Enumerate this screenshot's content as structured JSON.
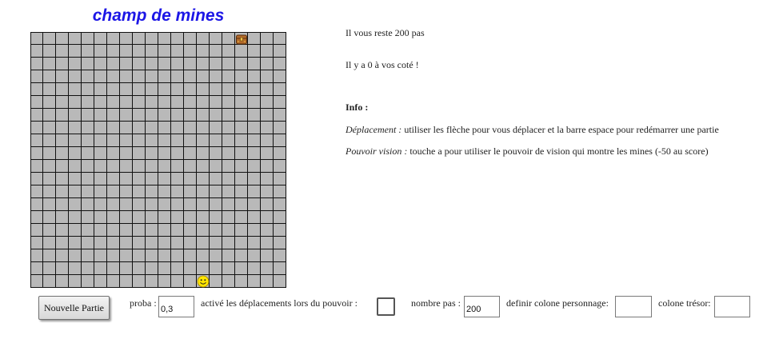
{
  "title": "champ de mines",
  "grid": {
    "cols": 20,
    "rows": 20,
    "treasure": {
      "col": 16,
      "row": 0
    },
    "player": {
      "col": 13,
      "row": 19
    }
  },
  "info": {
    "steps_left": "Il vous reste 200 pas",
    "adjacent": "Il y a 0 à vos coté !",
    "heading": "Info :",
    "move_label": "Déplacement :",
    "move_text": " utiliser les flèche pour vous déplacer et la barre espace pour redémarrer une partie",
    "vision_label": "Pouvoir vision :",
    "vision_text": " touche a pour utiliser le pouvoir de vision qui montre les mines (-50 au score)"
  },
  "controls": {
    "new_game": "Nouvelle Partie",
    "proba_label": "proba :",
    "proba_value": "0,3",
    "moves_label": "activé les déplacements lors du pouvoir :",
    "moves_checked": false,
    "steps_label": "nombre pas :",
    "steps_value": "200",
    "player_col_label": "definir colone personnage:",
    "player_col_value": "",
    "treasure_col_label": "colone trésor:",
    "treasure_col_value": ""
  },
  "icons": {
    "treasure": "treasure-chest-icon",
    "player": "smiley-face-icon"
  },
  "colors": {
    "title": "#1c16e6",
    "cell": "#b9b9b9",
    "grid_line": "#111111",
    "smiley": "#ffe500"
  }
}
